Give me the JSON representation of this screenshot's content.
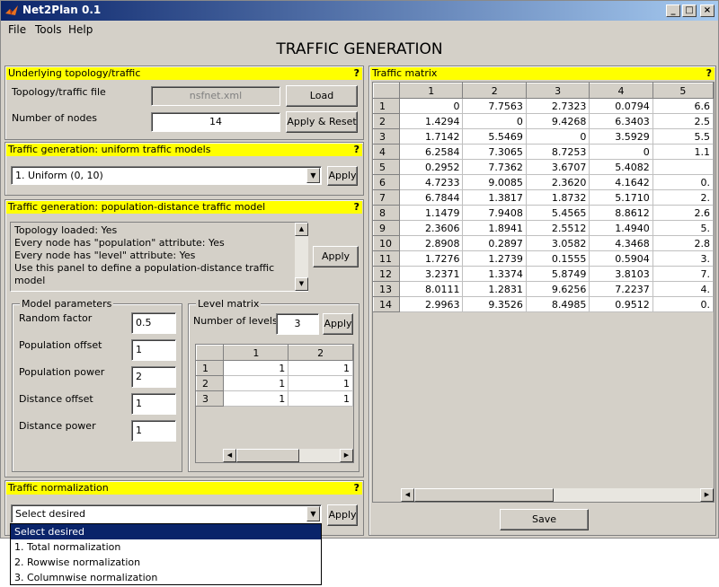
{
  "window": {
    "title": "Net2Plan 0.1",
    "min": "_",
    "max": "□",
    "close": "×"
  },
  "menu": {
    "file": "File",
    "tools": "Tools",
    "help": "Help"
  },
  "page_title": "TRAFFIC GENERATION",
  "help_mark": "?",
  "topology": {
    "header": "Underlying topology/traffic",
    "file_label": "Topology/traffic file",
    "file_value": "nsfnet.xml",
    "load_label": "Load",
    "nodes_label": "Number of nodes",
    "nodes_value": "14",
    "apply_reset_label": "Apply & Reset"
  },
  "uniform": {
    "header": "Traffic generation: uniform traffic models",
    "selected": "1. Uniform (0, 10)",
    "apply_label": "Apply"
  },
  "popdist": {
    "header": "Traffic generation: population-distance traffic model",
    "log": [
      "Topology loaded: Yes",
      "Every node has \"population\" attribute: Yes",
      "Every node has \"level\" attribute: Yes",
      "Use this panel to define a population-distance traffic model"
    ],
    "apply_label": "Apply",
    "model_params": {
      "title": "Model parameters",
      "random_factor_label": "Random factor",
      "random_factor": "0.5",
      "pop_offset_label": "Population offset",
      "pop_offset": "1",
      "pop_power_label": "Population power",
      "pop_power": "2",
      "dist_offset_label": "Distance offset",
      "dist_offset": "1",
      "dist_power_label": "Distance power",
      "dist_power": "1"
    },
    "level_matrix": {
      "title": "Level matrix",
      "levels_label": "Number of levels",
      "levels_value": "3",
      "apply_label": "Apply",
      "columns": [
        "1",
        "2"
      ],
      "rows": [
        {
          "h": "1",
          "c": [
            "1",
            "1"
          ]
        },
        {
          "h": "2",
          "c": [
            "1",
            "1"
          ]
        },
        {
          "h": "3",
          "c": [
            "1",
            "1"
          ]
        }
      ]
    }
  },
  "normalization": {
    "header": "Traffic normalization",
    "selected": "Select desired",
    "apply_label": "Apply",
    "options": [
      "Select desired",
      "1. Total normalization",
      "2. Rowwise normalization",
      "3. Columnwise normalization"
    ]
  },
  "matrix": {
    "header": "Traffic matrix",
    "columns": [
      "1",
      "2",
      "3",
      "4",
      "5"
    ],
    "rows": [
      {
        "h": "1",
        "c": [
          "0",
          "7.7563",
          "2.7323",
          "0.0794",
          "6.6"
        ]
      },
      {
        "h": "2",
        "c": [
          "1.4294",
          "0",
          "9.4268",
          "6.3403",
          "2.5"
        ]
      },
      {
        "h": "3",
        "c": [
          "1.7142",
          "5.5469",
          "0",
          "3.5929",
          "5.5"
        ]
      },
      {
        "h": "4",
        "c": [
          "6.2584",
          "7.3065",
          "8.7253",
          "0",
          "1.1"
        ]
      },
      {
        "h": "5",
        "c": [
          "0.2952",
          "7.7362",
          "3.6707",
          "5.4082",
          ""
        ]
      },
      {
        "h": "6",
        "c": [
          "4.7233",
          "9.0085",
          "2.3620",
          "4.1642",
          "0."
        ]
      },
      {
        "h": "7",
        "c": [
          "6.7844",
          "1.3817",
          "1.8732",
          "5.1710",
          "2."
        ]
      },
      {
        "h": "8",
        "c": [
          "1.1479",
          "7.9408",
          "5.4565",
          "8.8612",
          "2.6"
        ]
      },
      {
        "h": "9",
        "c": [
          "2.3606",
          "1.8941",
          "2.5512",
          "1.4940",
          "5."
        ]
      },
      {
        "h": "10",
        "c": [
          "2.8908",
          "0.2897",
          "3.0582",
          "4.3468",
          "2.8"
        ]
      },
      {
        "h": "11",
        "c": [
          "1.7276",
          "1.2739",
          "0.1555",
          "0.5904",
          "3."
        ]
      },
      {
        "h": "12",
        "c": [
          "3.2371",
          "1.3374",
          "5.8749",
          "3.8103",
          "7."
        ]
      },
      {
        "h": "13",
        "c": [
          "8.0111",
          "1.2831",
          "9.6256",
          "7.2237",
          "4."
        ]
      },
      {
        "h": "14",
        "c": [
          "2.9963",
          "9.3526",
          "8.4985",
          "0.9512",
          "0."
        ]
      }
    ],
    "save_label": "Save"
  }
}
